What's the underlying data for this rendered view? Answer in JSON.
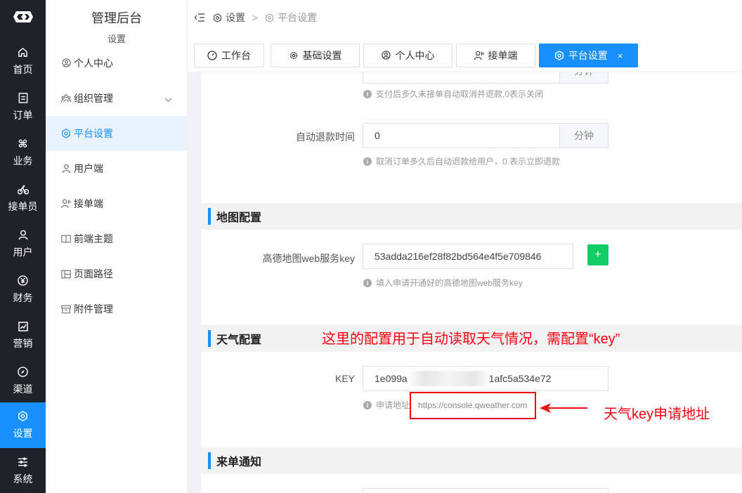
{
  "rail": {
    "items": [
      {
        "label": "首页",
        "icon": "home-icon"
      },
      {
        "label": "订单",
        "icon": "order-icon"
      },
      {
        "label": "业务",
        "icon": "command-icon"
      },
      {
        "label": "接单员",
        "icon": "bike-icon"
      },
      {
        "label": "用户",
        "icon": "user-icon"
      },
      {
        "label": "财务",
        "icon": "yuan-icon"
      },
      {
        "label": "营销",
        "icon": "chart-icon"
      },
      {
        "label": "渠道",
        "icon": "compass-icon"
      },
      {
        "label": "设置",
        "icon": "settings-icon"
      },
      {
        "label": "系统",
        "icon": "sliders-icon"
      }
    ]
  },
  "submenu": {
    "title": "管理后台",
    "subtitle": "设置",
    "items": [
      {
        "label": "个人中心"
      },
      {
        "label": "组织管理"
      },
      {
        "label": "平台设置"
      },
      {
        "label": "用户端"
      },
      {
        "label": "接单端"
      },
      {
        "label": "前端主题"
      },
      {
        "label": "页面路径"
      },
      {
        "label": "附件管理"
      }
    ]
  },
  "breadcrumb": {
    "first": "设置",
    "separator": ">",
    "second": "平台设置"
  },
  "tabs": [
    {
      "label": "工作台"
    },
    {
      "label": "基础设置"
    },
    {
      "label": "个人中心"
    },
    {
      "label": "接单端"
    },
    {
      "label": "平台设置",
      "close": "×"
    }
  ],
  "form": {
    "top_hint": "支付后多久未接单自动取消并退款,0表示关闭",
    "top_append": "分钟",
    "refund_label": "自动退款时间",
    "refund_value": "0",
    "refund_append": "分钟",
    "refund_hint": "取消订单多久后自动退款给用户，0 表示立即退款",
    "map_section": "地图配置",
    "amap_label": "高德地图web服务key",
    "amap_value": "53adda216ef28f82bd564e4f5e709846",
    "amap_plus": "+",
    "amap_hint": "填入申请开通好的高德地图web服务key",
    "weather_section": "天气配置",
    "weather_key_label": "KEY",
    "weather_key_prefix": "1e099a",
    "weather_key_suffix": "1afc5a534e72",
    "weather_hint_prefix": "申请地址",
    "weather_url": "https://console.qweather.com",
    "notify_section": "来单通知"
  },
  "annotations": {
    "headline": "这里的配置用于自动读取天气情况，需配置“key”",
    "arrow_note": "天气key申请地址",
    "color": "#ff1111"
  },
  "colors": {
    "accent": "#1890ff",
    "rail": "#1f2329",
    "green": "#13ce66"
  }
}
